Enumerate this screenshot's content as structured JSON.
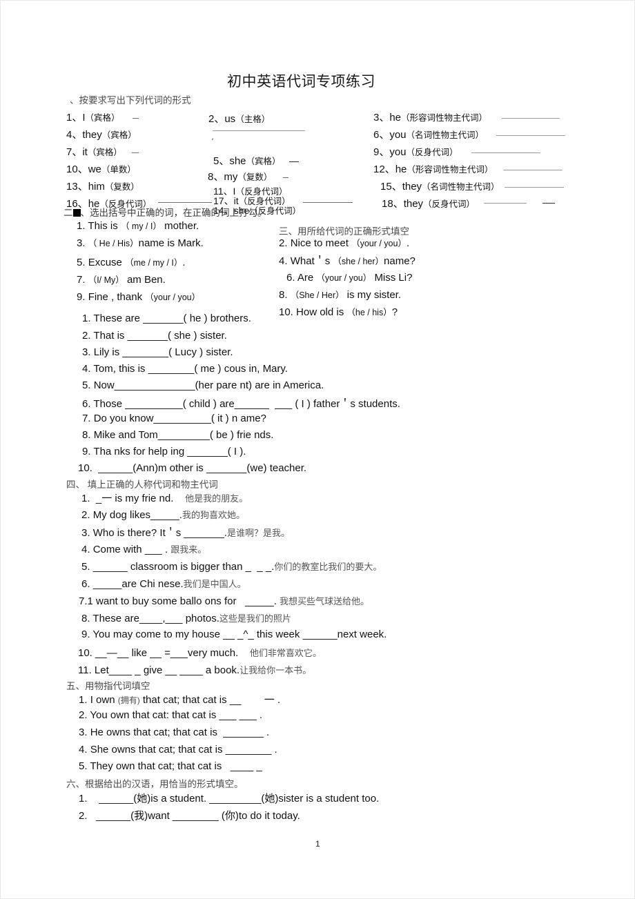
{
  "document": {
    "title": "初中英语代词专项练习",
    "page_number": "1"
  },
  "section1": {
    "heading": "、按要求写出下列代词的形式",
    "left_items": [
      {
        "num": "1、",
        "word": "I",
        "form": "（宾格）"
      },
      {
        "num": "4、",
        "word": "they",
        "form": "（宾格）"
      },
      {
        "num": "7、",
        "word": "it",
        "form": "（宾格）"
      },
      {
        "num": "10、",
        "word": "we",
        "form": "（单数）"
      },
      {
        "num": "13、",
        "word": "him",
        "form": "（复数）"
      },
      {
        "num": "16、",
        "word": "he",
        "form": "（反身代词）"
      }
    ],
    "mid_items": [
      {
        "num": "2、",
        "word": "us",
        "form": "（主格）"
      },
      {
        "num": "5、",
        "word": "she",
        "form": "（宾格）"
      },
      {
        "num": "8、",
        "word": "my",
        "form": "（复数）"
      },
      {
        "num": "11、",
        "word": "I",
        "form": "（反身代词）"
      },
      {
        "num": "17、",
        "word": "it",
        "form": "（反身代词）"
      },
      {
        "num": "14、",
        "word": "she",
        "form": "（反身代词）"
      }
    ],
    "right_items": [
      {
        "num": "3、",
        "word": "he",
        "form": "（形容词性物主代词）"
      },
      {
        "num": "6、",
        "word": "you",
        "form": "（名词性物主代词）"
      },
      {
        "num": "9、",
        "word": "you",
        "form": "（反身代词）"
      },
      {
        "num": "12、",
        "word": "he",
        "form": "（形容词性物主代词）"
      },
      {
        "num": "15、",
        "word": "they",
        "form": "（名词性物主代词）"
      },
      {
        "num": "18、",
        "word": "they",
        "form": "（反身代词）"
      }
    ]
  },
  "section2": {
    "heading_prefix": "二",
    "heading": "、选出括号中正确的词，在正确的词上打勾。",
    "left_items": [
      {
        "num": "1.",
        "pre": "This is",
        "choice": "（ my / I）",
        "post": "mother."
      },
      {
        "num": "3.",
        "pre": "",
        "choice": "（ He / His）",
        "post": "name is Mark."
      },
      {
        "num": "5.",
        "pre": "Excuse",
        "choice": "（me / my / I）",
        "post": "."
      },
      {
        "num": "7.",
        "pre": "",
        "choice": "（I/ My）",
        "post": "am Ben."
      },
      {
        "num": "9.",
        "pre": "Fine , thank",
        "choice": "（your / you）",
        "post": ""
      }
    ]
  },
  "section3_head": {
    "heading": "三、用所给代词的正确形式填空"
  },
  "section2_right": {
    "items": [
      {
        "num": "2.",
        "pre": "Nice to meet",
        "choice": "（your / you）",
        "post": "."
      },
      {
        "num": "4.",
        "pre": "What＇s",
        "choice": "（she / her）",
        "post": "name?"
      },
      {
        "num": "6.",
        "pre": "Are",
        "choice": "（your / you）",
        "post": "Miss Li?"
      },
      {
        "num": "8.",
        "pre": "",
        "choice": "（She / Her）",
        "post": "is my sister."
      },
      {
        "num": "10.",
        "pre": "How old is",
        "choice": "（he / his）",
        "post": "?"
      }
    ]
  },
  "section3": {
    "items": [
      {
        "num": "1.",
        "pre": "These are",
        "blank": "_______",
        "hint": "( he )",
        "post": "brothers."
      },
      {
        "num": "2.",
        "pre": "That is",
        "blank": "_______",
        "hint": "( she )",
        "post": "sister."
      },
      {
        "num": "3.",
        "pre": "Lily is",
        "blank": "________",
        "hint": "( Lucy )",
        "post": "sister."
      },
      {
        "num": "4.",
        "pre": "Tom, this is",
        "blank": "________",
        "hint": "( me )",
        "post": "cous in, Mary."
      },
      {
        "num": "5.",
        "pre": "Now",
        "blank": "______________",
        "hint": "(her pare nt)",
        "post": "are in America."
      },
      {
        "num": "6.",
        "pre": "Those",
        "blank": "__________",
        "hint": "( child )",
        "post": "are______  ___ ( I ) father＇s students."
      },
      {
        "num": "7.",
        "pre": "Do you know",
        "blank": "__________",
        "hint": "( it )",
        "post": "n ame?"
      },
      {
        "num": "8.",
        "pre": "Mike and Tom",
        "blank": "_________",
        "hint": "( be )",
        "post": "frie nds."
      },
      {
        "num": "9.",
        "pre": "Tha nks for help ing",
        "blank": "_______",
        "hint": "( I )",
        "post": "."
      },
      {
        "num": "10.",
        "pre": "",
        "blank": "______",
        "hint": "(Ann)",
        "post": "m other is _______(we) teacher."
      }
    ]
  },
  "section4": {
    "heading": "四、 填上正确的人称代词和物主代词",
    "items": [
      {
        "num": "1.",
        "text": "_一 is my frie nd.",
        "cn": "他是我的朋友。"
      },
      {
        "num": "2.",
        "text": "My dog likes_____.",
        "cn": "我的狗喜欢她。"
      },
      {
        "num": "3.",
        "text": "Who is there? It＇s _______.",
        "cn": "是谁啊？是我。"
      },
      {
        "num": "4.",
        "text": "Come with ___ .",
        "cn": "跟我来。"
      },
      {
        "num": "5.",
        "text": "______ classroom is bigger than _  _ _.",
        "cn": "你们的教室比我们的要大。"
      },
      {
        "num": "6.",
        "text": "_____are Chi nese.",
        "cn": "我们是中国人。"
      },
      {
        "num": "7.1",
        "text": "want to buy some ballo ons for   _____.",
        "cn": "我想买些气球送给他。"
      },
      {
        "num": "8.",
        "text": "These are____,___ photos.",
        "cn": "这些是我们的照片"
      },
      {
        "num": "9.",
        "text": "You may come to my house __ _^_ this week ______next week.",
        "cn": ""
      },
      {
        "num": "10.",
        "text": "__—__ like __ =___very much.",
        "cn": "他们非常喜欢它。"
      },
      {
        "num": "11.",
        "text": "Let____ _ give __ ____ a book.",
        "cn": "让我给你一本书。"
      }
    ]
  },
  "section5": {
    "heading": "五、用物指代词填空",
    "items": [
      {
        "num": "1.",
        "text": "I own",
        "paren": "(拥有)",
        "rest": "that cat; that cat is __        一 ."
      },
      {
        "num": "2.",
        "text": "You own that cat: that cat is ___ ___ .",
        "paren": "",
        "rest": ""
      },
      {
        "num": "3.",
        "text": "He owns that cat; that cat is  _______ .",
        "paren": "",
        "rest": ""
      },
      {
        "num": "4.",
        "text": "She owns that cat; that cat is ________ .",
        "paren": "",
        "rest": ""
      },
      {
        "num": "5.",
        "text": "They own that cat; that cat is   ____ _",
        "paren": "",
        "rest": ""
      }
    ]
  },
  "section6": {
    "heading": "六、根据给出的汉语，用恰当的形式填空。",
    "items": [
      {
        "num": "1.",
        "text": "______(她)is a student. _________(她)sister is a student too."
      },
      {
        "num": "2.",
        "text": "______(我)want ________ (你)to do it today."
      }
    ]
  },
  "colors": {
    "text": "#111111",
    "heading_gray": "#4a4a4a",
    "chinese_gray": "#555555",
    "rule": "#6d6d6d",
    "frame": "#e8e8e8"
  }
}
